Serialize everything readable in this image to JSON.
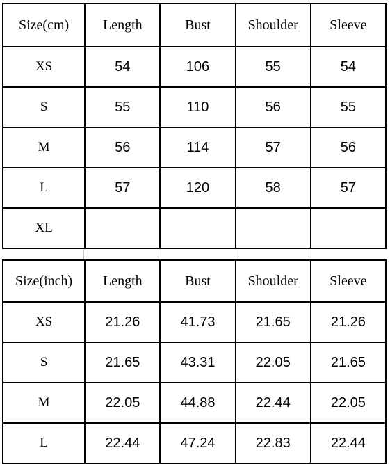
{
  "tables": [
    {
      "unit_header": "Size(cm)",
      "columns": [
        "Length",
        "Bust",
        "Shoulder",
        "Sleeve"
      ],
      "rows": [
        {
          "size": "XS",
          "values": [
            "54",
            "106",
            "55",
            "54"
          ]
        },
        {
          "size": "S",
          "values": [
            "55",
            "110",
            "56",
            "55"
          ]
        },
        {
          "size": "M",
          "values": [
            "56",
            "114",
            "57",
            "56"
          ]
        },
        {
          "size": "L",
          "values": [
            "57",
            "120",
            "58",
            "57"
          ]
        },
        {
          "size": "XL",
          "values": [
            "",
            "",
            "",
            ""
          ]
        }
      ]
    },
    {
      "unit_header": "Size(inch)",
      "columns": [
        "Length",
        "Bust",
        "Shoulder",
        "Sleeve"
      ],
      "rows": [
        {
          "size": "XS",
          "values": [
            "21.26",
            "41.73",
            "21.65",
            "21.26"
          ]
        },
        {
          "size": "S",
          "values": [
            "21.65",
            "43.31",
            "22.05",
            "21.65"
          ]
        },
        {
          "size": "M",
          "values": [
            "22.05",
            "44.88",
            "22.44",
            "22.05"
          ]
        },
        {
          "size": "L",
          "values": [
            "22.44",
            "47.24",
            "22.83",
            "22.44"
          ]
        }
      ]
    }
  ],
  "colors": {
    "header_blue": "#9dc8f5",
    "border": "#000000",
    "text": "#111111",
    "background": "#ffffff"
  }
}
